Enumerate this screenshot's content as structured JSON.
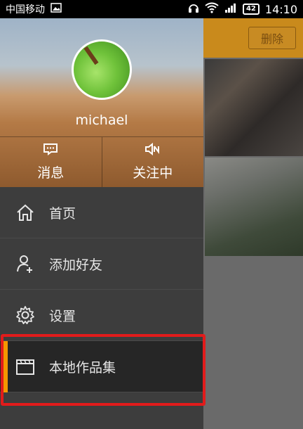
{
  "status_bar": {
    "carrier": "中国移动",
    "battery": "42",
    "time": "14:10"
  },
  "background_screen": {
    "delete_label": "删除"
  },
  "drawer": {
    "username": "michael",
    "actions": [
      {
        "label": "消息",
        "icon": "message-icon"
      },
      {
        "label": "关注中",
        "icon": "speaker-muted-icon"
      }
    ],
    "menu": [
      {
        "label": "首页",
        "icon": "home-icon",
        "active": false
      },
      {
        "label": "添加好友",
        "icon": "add-friend-icon",
        "active": false
      },
      {
        "label": "设置",
        "icon": "gear-icon",
        "active": false
      },
      {
        "label": "本地作品集",
        "icon": "folder-icon",
        "active": true
      }
    ]
  },
  "colors": {
    "accent": "#f39800",
    "highlight": "#e21b1b",
    "drawer_bg": "#3d3d3d"
  }
}
